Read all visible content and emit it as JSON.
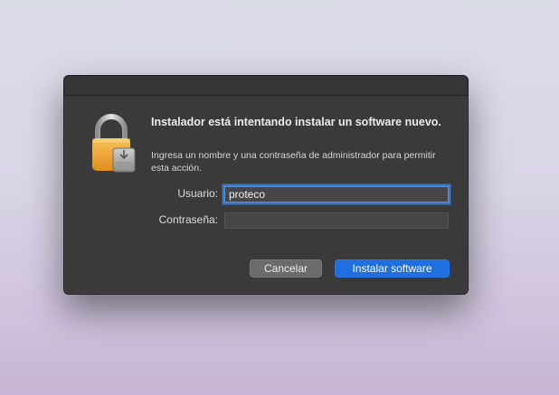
{
  "dialog": {
    "icon": "lock-with-installer-icon",
    "title": "Instalador está intentando instalar un software nuevo.",
    "description": "Ingresa un nombre y una contraseña de administrador para permitir esta acción.",
    "username_label": "Usuario:",
    "username_value": "proteco",
    "password_label": "Contraseña:",
    "password_value": "",
    "cancel_label": "Cancelar",
    "confirm_label": "Instalar software"
  },
  "colors": {
    "accent": "#1f6fe0",
    "lock_gold": "#f0a93a",
    "dialog_bg": "#3a3a3b"
  }
}
